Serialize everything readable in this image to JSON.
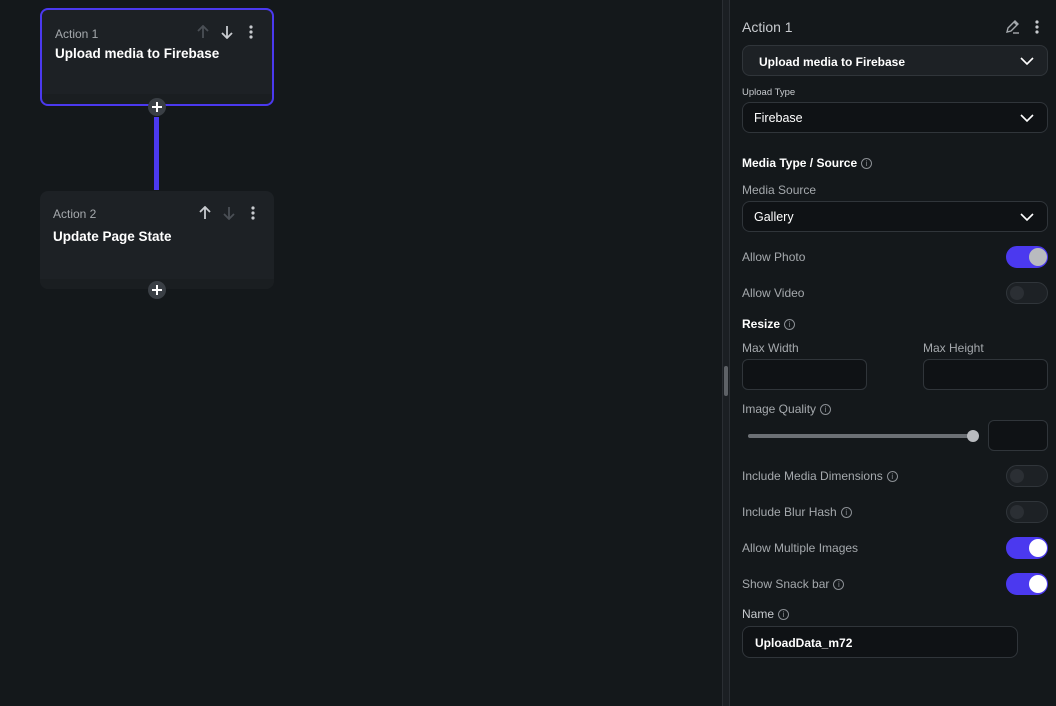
{
  "canvas": {
    "action1": {
      "label": "Action 1",
      "title": "Upload media to Firebase"
    },
    "action2": {
      "label": "Action 2",
      "title": "Update Page State"
    }
  },
  "panel": {
    "header": {
      "title": "Action 1"
    },
    "action_type": {
      "value": "Upload media to Firebase"
    },
    "upload_type": {
      "label": "Upload Type",
      "value": "Firebase"
    },
    "media_section": {
      "title": "Media Type / Source"
    },
    "media_source": {
      "label": "Media Source",
      "value": "Gallery"
    },
    "allow_photo": {
      "label": "Allow Photo",
      "on": true
    },
    "allow_video": {
      "label": "Allow Video",
      "on": false
    },
    "resize": {
      "title": "Resize",
      "max_width_label": "Max Width",
      "max_height_label": "Max Height"
    },
    "image_quality": {
      "label": "Image Quality",
      "value": 1.0
    },
    "include_media_dimensions": {
      "label": "Include Media Dimensions",
      "on": false
    },
    "include_blur_hash": {
      "label": "Include Blur Hash",
      "on": false
    },
    "allow_multiple_images": {
      "label": "Allow Multiple Images",
      "on": true
    },
    "show_snack_bar": {
      "label": "Show Snack bar",
      "on": true
    },
    "name": {
      "label": "Name",
      "value": "UploadData_m72"
    }
  },
  "colors": {
    "accent": "#4b39ef",
    "background": "#14181b",
    "surface": "#1d2125"
  }
}
